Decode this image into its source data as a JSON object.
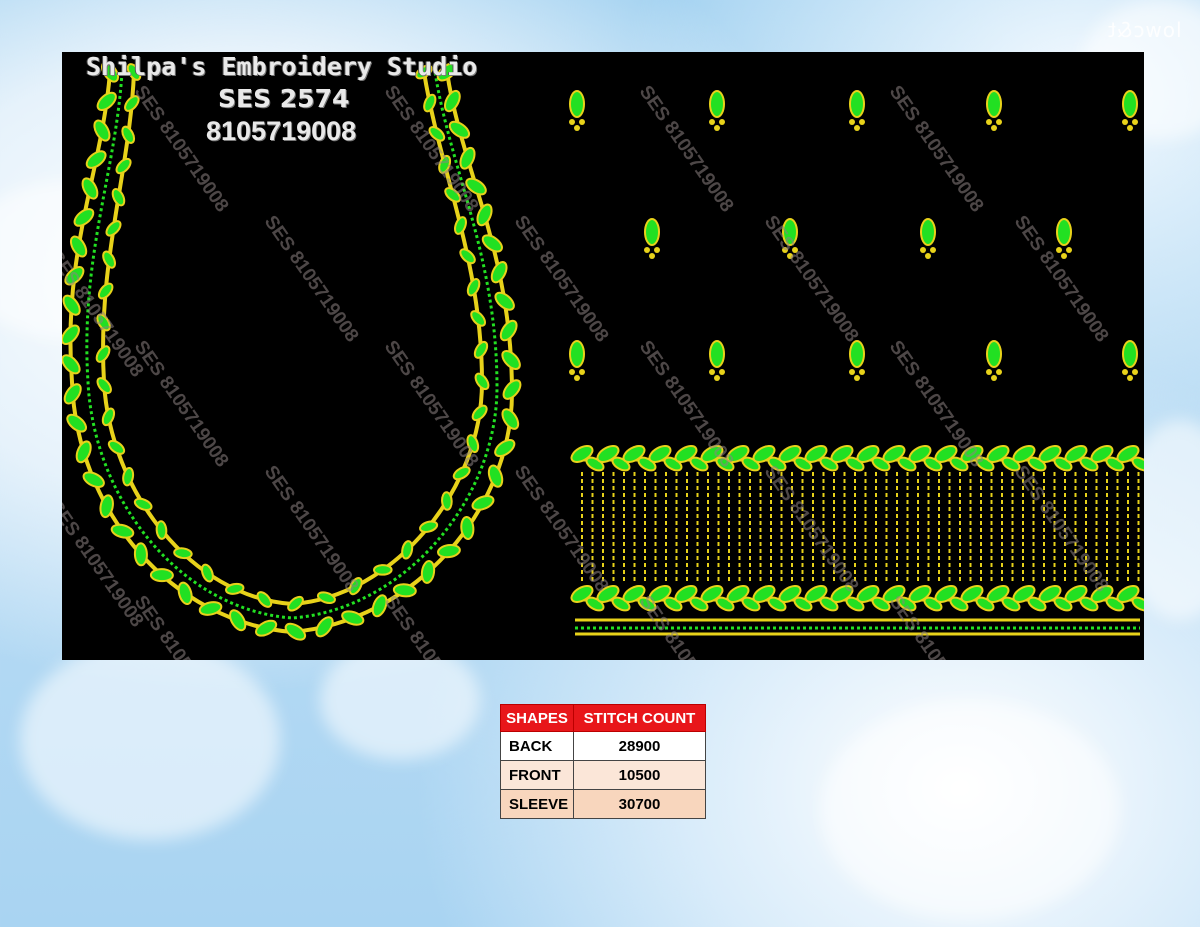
{
  "corner_logo": "lowc&t",
  "design": {
    "studio_name": "Shilpa's Embroidery Studio",
    "design_code": "SES 2574",
    "phone": "8105719008",
    "watermark": "SES 8105719008",
    "colors": {
      "background": "#000000",
      "leaf": "#22e022",
      "leaf_outline": "#e8d21a",
      "gold": "#e8d21a"
    }
  },
  "stitch_table": {
    "headers": [
      "SHAPES",
      "STITCH COUNT"
    ],
    "rows": [
      {
        "shape": "BACK",
        "count": "28900"
      },
      {
        "shape": "FRONT",
        "count": "10500"
      },
      {
        "shape": "SLEEVE",
        "count": "30700"
      }
    ],
    "header_color": "#e8161a"
  }
}
